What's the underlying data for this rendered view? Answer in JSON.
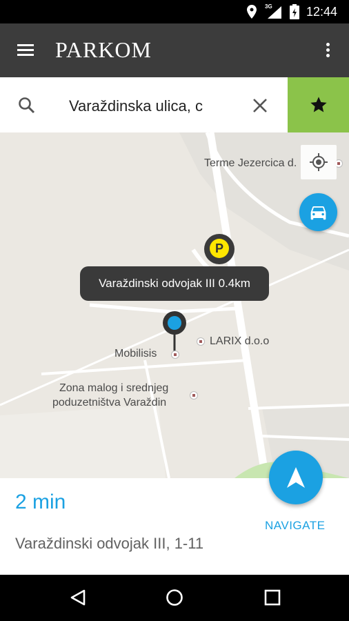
{
  "status_bar": {
    "time": "12:44",
    "signal_type": "3G",
    "icons": [
      "location-icon",
      "signal-icon",
      "battery-icon"
    ]
  },
  "app_bar": {
    "logo_text": "PARKOM",
    "menu_icon": "hamburger-menu-icon",
    "overflow_icon": "more-vertical-icon"
  },
  "search": {
    "value": "Varaždinska ulica, c",
    "search_icon": "search-icon",
    "clear_icon": "close-icon",
    "favorite_icon": "star-icon",
    "favorite_color": "#8bc34a"
  },
  "map": {
    "labels": {
      "terme": "Terme Jezercica d.",
      "larix": "LARIX d.o.o",
      "mobilisis": "Mobilisis",
      "zona_line1": "Zona malog i srednjeg",
      "zona_line2": "poduzetništva Varaždin"
    },
    "parking_marker_label": "P",
    "tooltip": "Varaždinski odvojak III 0.4km",
    "locate_button_icon": "my-location-icon",
    "car_button_icon": "car-icon",
    "accent_color": "#1ba1e2",
    "parking_color": "#ffe600"
  },
  "route": {
    "duration": "2 min",
    "address": "Varaždinski odvojak III, 1-11",
    "navigate_label": "NAVIGATE",
    "navigate_icon": "navigation-arrow-icon"
  },
  "nav_bar": {
    "back_icon": "back-icon",
    "home_icon": "home-icon",
    "recents_icon": "recents-icon"
  }
}
